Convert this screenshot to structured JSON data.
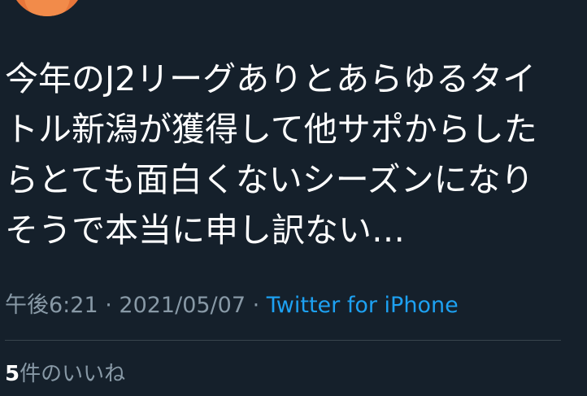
{
  "tweet": {
    "handle_fragment": "‾ ‾",
    "text": "今年のJ2リーグありとあらゆるタイ\nトル新潟が獲得して他サポからした\nらとても面白くないシーズンになり\nそうで本当に申し訳ない…",
    "time": "午後6:21",
    "sep1": " · ",
    "date": "2021/05/07",
    "sep2": " · ",
    "source": "Twitter for iPhone"
  },
  "likes": {
    "count": "5",
    "label": "件のいいね"
  },
  "colors": {
    "background": "#15202b",
    "text": "#ffffff",
    "secondary": "#8899a6",
    "link": "#1da1f2",
    "divider": "#38444d",
    "avatar": "#e8763a"
  }
}
